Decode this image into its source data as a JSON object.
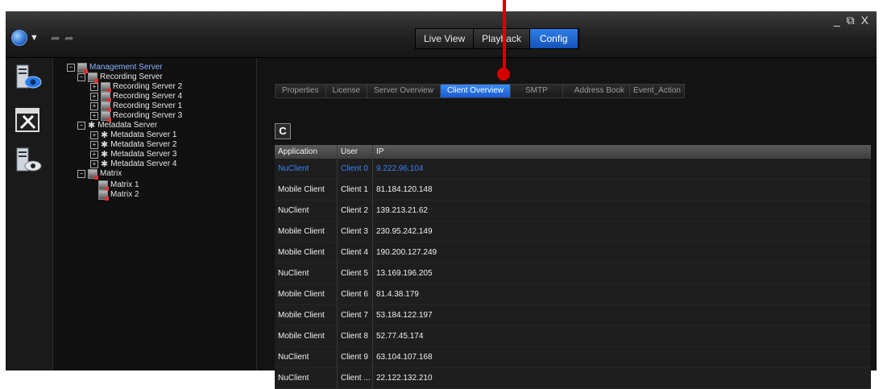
{
  "titlebar": {
    "mode_tabs": [
      {
        "label": "Live View",
        "active": false
      },
      {
        "label": "Playback",
        "active": false
      },
      {
        "label": "Config",
        "active": true
      }
    ],
    "window_controls": [
      "_",
      "⧉",
      "X"
    ],
    "icons": {
      "menu": "globe-icon",
      "back": "back-arrow-icon",
      "forward": "forward-arrow-icon"
    }
  },
  "sidebar": {
    "icons": [
      "server-view-icon",
      "tools-icon",
      "server-monitor-icon"
    ]
  },
  "tree": {
    "root": "Management Server",
    "recording_group": "Recording Server",
    "recording_servers": [
      "Recording Server 2",
      "Recording Server 4",
      "Recording Server 1",
      "Recording Server 3"
    ],
    "metadata_group": "Metadata Server",
    "metadata_servers": [
      "Metadata Server 1",
      "Metadata Server 2",
      "Metadata Server 3",
      "Metadata Server 4"
    ],
    "matrix_group": "Matrix",
    "matrices": [
      "Matrix 1",
      "Matrix 2"
    ]
  },
  "subtabs": [
    {
      "label": "Properties",
      "active": false
    },
    {
      "label": "License",
      "active": false
    },
    {
      "label": "Server Overview",
      "active": false
    },
    {
      "label": "Client Overview",
      "active": true
    },
    {
      "label": "SMTP",
      "active": false
    },
    {
      "label": "Address Book",
      "active": false
    },
    {
      "label": "Event_Action",
      "active": false
    }
  ],
  "refresh_label": "C",
  "table": {
    "columns": [
      "Application",
      "User",
      "IP"
    ],
    "rows": [
      {
        "application": "NuClient",
        "user": "Client 0",
        "ip": "9.222.96.104",
        "selected": true
      },
      {
        "application": "Mobile Client",
        "user": "Client 1",
        "ip": "81.184.120.148",
        "selected": false
      },
      {
        "application": "NuClient",
        "user": "Client 2",
        "ip": "139.213.21.62",
        "selected": false
      },
      {
        "application": "Mobile Client",
        "user": "Client 3",
        "ip": "230.95.242.149",
        "selected": false
      },
      {
        "application": "Mobile Client",
        "user": "Client 4",
        "ip": "190.200.127.249",
        "selected": false
      },
      {
        "application": "NuClient",
        "user": "Client 5",
        "ip": "13.169.196.205",
        "selected": false
      },
      {
        "application": "Mobile Client",
        "user": "Client 6",
        "ip": "81.4.38.179",
        "selected": false
      },
      {
        "application": "Mobile Client",
        "user": "Client 7",
        "ip": "53.184.122.197",
        "selected": false
      },
      {
        "application": "Mobile Client",
        "user": "Client 8",
        "ip": "52.77.45.174",
        "selected": false
      },
      {
        "application": "NuClient",
        "user": "Client 9",
        "ip": "63.104.107.168",
        "selected": false
      },
      {
        "application": "NuClient",
        "user": "Client ...",
        "ip": "22.122.132.210",
        "selected": false
      }
    ]
  },
  "colors": {
    "accent": "#1f6ae0",
    "selected_text": "#3d7ff5",
    "marker": "#d40000"
  }
}
